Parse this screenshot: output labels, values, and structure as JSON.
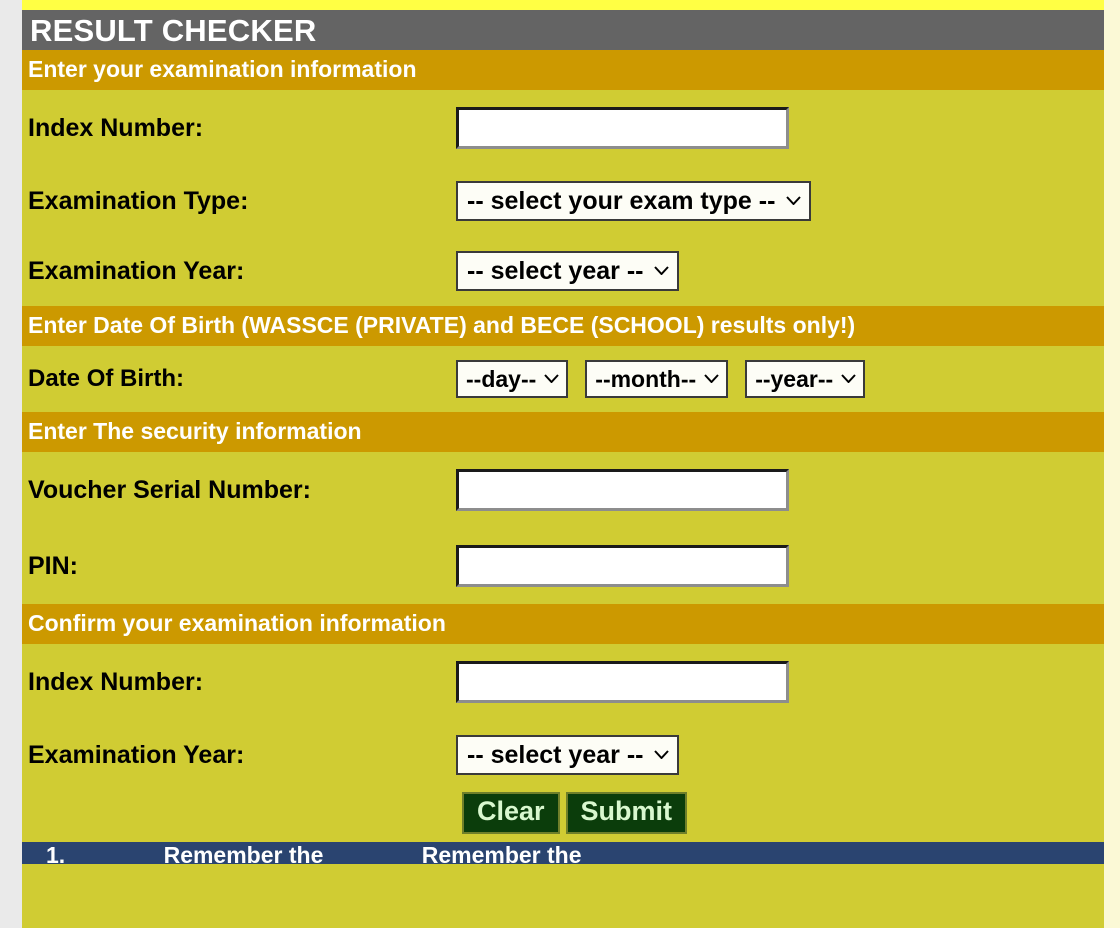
{
  "colors": {
    "title_bar": "#646464",
    "section_bar": "#cc9900",
    "body": "#d0cc33",
    "top_strip": "#ffff44",
    "button": "#0b3d0b",
    "button_text": "#d9f8cf",
    "footer": "#2a4470",
    "right_gutter": "#fbf9d6"
  },
  "header": {
    "title": "RESULT CHECKER"
  },
  "sections": {
    "exam_info": "Enter your examination information",
    "dob": "Enter Date Of Birth (WASSCE (PRIVATE) and BECE (SCHOOL) results only!)",
    "security": "Enter The security information",
    "confirm": "Confirm your examination information"
  },
  "fields": {
    "index_number_label": "Index Number:",
    "index_number_value": "",
    "exam_type_label": "Examination Type:",
    "exam_type_value": "-- select your exam type --",
    "exam_year_label": "Examination Year:",
    "exam_year_value": "-- select year --",
    "dob_label": "Date Of Birth:",
    "dob_day_value": "--day--",
    "dob_month_value": "--month--",
    "dob_year_value": "--year--",
    "voucher_label": "Voucher Serial Number:",
    "voucher_value": "",
    "pin_label": "PIN:",
    "pin_value": "",
    "confirm_index_label": "Index Number:",
    "confirm_index_value": "",
    "confirm_year_label": "Examination Year:",
    "confirm_year_value": "-- select year --"
  },
  "buttons": {
    "clear": "Clear",
    "submit": "Submit"
  },
  "footer": {
    "item_number": "1.",
    "text_a": "Remember the",
    "text_b": "Remember the"
  }
}
